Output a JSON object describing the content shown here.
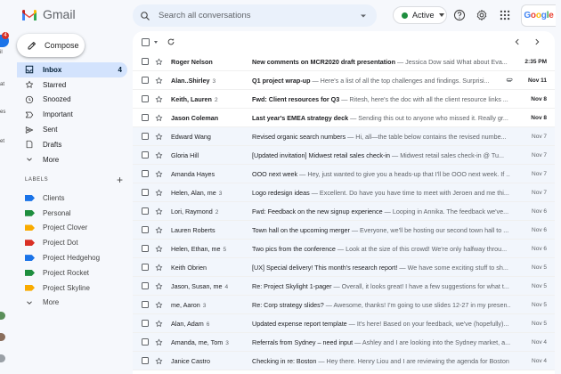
{
  "rail": {
    "badge": "4",
    "labels": [
      "il",
      "at",
      "es",
      "et"
    ]
  },
  "header": {
    "logo_text": "Gmail",
    "search_placeholder": "Search all conversations",
    "status": "Active",
    "account": "Google"
  },
  "compose_label": "Compose",
  "nav": [
    {
      "label": "Inbox",
      "count": "4",
      "icon": "inbox-icon"
    },
    {
      "label": "Starred",
      "count": "",
      "icon": "star-icon"
    },
    {
      "label": "Snoozed",
      "count": "",
      "icon": "clock-icon"
    },
    {
      "label": "Important",
      "count": "",
      "icon": "important-icon"
    },
    {
      "label": "Sent",
      "count": "",
      "icon": "send-icon"
    },
    {
      "label": "Drafts",
      "count": "",
      "icon": "draft-icon"
    },
    {
      "label": "More",
      "count": "",
      "icon": "chevron-down-icon"
    }
  ],
  "labels_title": "LABELS",
  "labels": [
    {
      "label": "Clients",
      "color": "#1a73e8"
    },
    {
      "label": "Personal",
      "color": "#1e8e3e"
    },
    {
      "label": "Project Clover",
      "color": "#f9ab00"
    },
    {
      "label": "Project Dot",
      "color": "#d93025"
    },
    {
      "label": "Project Hedgehog",
      "color": "#1a73e8"
    },
    {
      "label": "Project Rocket",
      "color": "#1e8e3e"
    },
    {
      "label": "Project Skyline",
      "color": "#f9ab00"
    },
    {
      "label": "More",
      "color": ""
    }
  ],
  "emails": [
    {
      "sender": "Roger Nelson",
      "count": "",
      "subject": "New comments on MCR2020 draft presentation",
      "snippet": " — Jessica Dow said What about Eva...",
      "date": "2:35 PM",
      "unread": true,
      "attachment": false
    },
    {
      "sender": "Alan..Shirley",
      "count": "3",
      "subject": "Q1 project wrap-up",
      "snippet": " — Here's a list of all the top challenges and findings. Surprisi...",
      "date": "Nov 11",
      "unread": true,
      "attachment": true
    },
    {
      "sender": "Keith, Lauren",
      "count": "2",
      "subject": "Fwd: Client resources for Q3",
      "snippet": " — Ritesh, here's the doc with all the client resource links ...",
      "date": "Nov 8",
      "unread": true,
      "attachment": false
    },
    {
      "sender": "Jason Coleman",
      "count": "",
      "subject": "Last year's EMEA strategy deck",
      "snippet": " — Sending this out to anyone who missed it. Really gr...",
      "date": "Nov 8",
      "unread": true,
      "attachment": false
    },
    {
      "sender": "Edward Wang",
      "count": "",
      "subject": "Revised organic search numbers",
      "snippet": " — Hi, all—the table below contains the revised numbe...",
      "date": "Nov 7",
      "unread": false,
      "attachment": false
    },
    {
      "sender": "Gloria Hill",
      "count": "",
      "subject": "[Updated invitation] Midwest retail sales check-in",
      "snippet": " — Midwest retail sales check-in @ Tu...",
      "date": "Nov 7",
      "unread": false,
      "attachment": false
    },
    {
      "sender": "Amanda Hayes",
      "count": "",
      "subject": "OOO next week",
      "snippet": " — Hey, just wanted to give you a heads-up that I'll be OOO next week. If ...",
      "date": "Nov 7",
      "unread": false,
      "attachment": false
    },
    {
      "sender": "Helen, Alan, me",
      "count": "3",
      "subject": "Logo redesign ideas",
      "snippet": " — Excellent. Do have you have time to meet with Jeroen and me thi...",
      "date": "Nov 7",
      "unread": false,
      "attachment": false
    },
    {
      "sender": "Lori, Raymond",
      "count": "2",
      "subject": "Fwd: Feedback on the new signup experience",
      "snippet": " — Looping in Annika. The feedback we've...",
      "date": "Nov 6",
      "unread": false,
      "attachment": false
    },
    {
      "sender": "Lauren Roberts",
      "count": "",
      "subject": "Town hall on the upcoming merger",
      "snippet": " — Everyone, we'll be hosting our second town hall to ...",
      "date": "Nov 6",
      "unread": false,
      "attachment": false
    },
    {
      "sender": "Helen, Ethan, me",
      "count": "5",
      "subject": "Two pics from the conference",
      "snippet": " — Look at the size of this crowd! We're only halfway throu...",
      "date": "Nov 6",
      "unread": false,
      "attachment": false
    },
    {
      "sender": "Keith Obrien",
      "count": "",
      "subject": "[UX] Special delivery! This month's research report!",
      "snippet": " — We have some exciting stuff to sh...",
      "date": "Nov 5",
      "unread": false,
      "attachment": false
    },
    {
      "sender": "Jason, Susan, me",
      "count": "4",
      "subject": "Re: Project Skylight 1-pager",
      "snippet": " — Overall, it looks great! I have a few suggestions for what t...",
      "date": "Nov 5",
      "unread": false,
      "attachment": false
    },
    {
      "sender": "me, Aaron",
      "count": "3",
      "subject": "Re: Corp strategy slides?",
      "snippet": " — Awesome, thanks! I'm going to use slides 12-27 in my presen...",
      "date": "Nov 5",
      "unread": false,
      "attachment": false
    },
    {
      "sender": "Alan, Adam",
      "count": "6",
      "subject": "Updated expense report template",
      "snippet": " — It's here! Based on your feedback, we've (hopefully)...",
      "date": "Nov 5",
      "unread": false,
      "attachment": false
    },
    {
      "sender": "Amanda, me, Tom",
      "count": "3",
      "subject": "Referrals from Sydney – need input",
      "snippet": " — Ashley and I are looking into the Sydney market, a...",
      "date": "Nov 4",
      "unread": false,
      "attachment": false
    },
    {
      "sender": "Janice Castro",
      "count": "",
      "subject": "Checking in re: Boston",
      "snippet": " — Hey there. Henry Liou and I are reviewing the agenda for Boston ...",
      "date": "Nov 4",
      "unread": false,
      "attachment": false
    }
  ]
}
